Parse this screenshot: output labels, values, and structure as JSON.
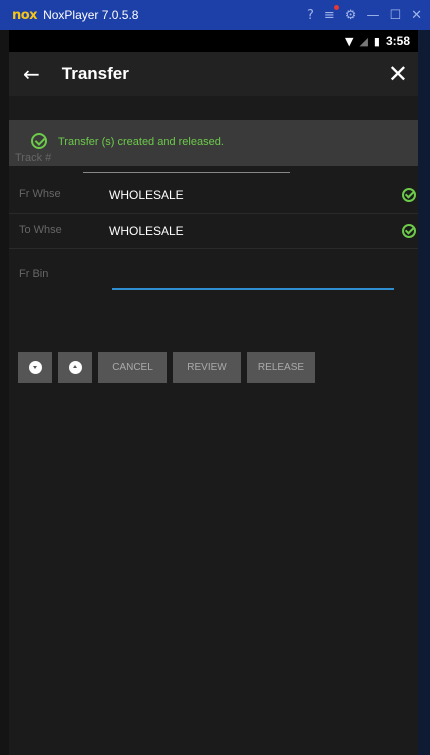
{
  "window": {
    "logo": "nox",
    "title": "NoxPlayer 7.0.5.8",
    "controls": [
      {
        "name": "help-icon",
        "glyph": "?⃝"
      },
      {
        "name": "menu-icon",
        "glyph": "≡"
      },
      {
        "name": "settings-icon",
        "glyph": "⚙"
      },
      {
        "name": "minimize-icon",
        "glyph": "—"
      },
      {
        "name": "maximize-icon",
        "glyph": "☐"
      },
      {
        "name": "close-window-icon",
        "glyph": "✕"
      }
    ]
  },
  "status_bar": {
    "time": "3:58",
    "icons": [
      "wifi-icon",
      "signal-off-icon",
      "battery-icon"
    ]
  },
  "app_bar": {
    "back_glyph": "←",
    "title": "Transfer",
    "close_glyph": "✕"
  },
  "banner": {
    "message": "Transfer (s) created and released.",
    "color": "#6ccb4a"
  },
  "form": {
    "track_label": "Track #",
    "fr_whse_label": "Fr Whse",
    "fr_whse_value": "WHOLESALE",
    "to_whse_label": "To Whse",
    "to_whse_value": "WHOLESALE",
    "fr_bin_label": "Fr Bin",
    "fr_bin_value": ""
  },
  "actions": {
    "cancel": "CANCEL",
    "review": "REVIEW",
    "release": "RELEASE"
  },
  "colors": {
    "accent_blue": "#2f8ecf",
    "success_green": "#6ccb4a",
    "nox_blue": "#1c3fa8"
  }
}
